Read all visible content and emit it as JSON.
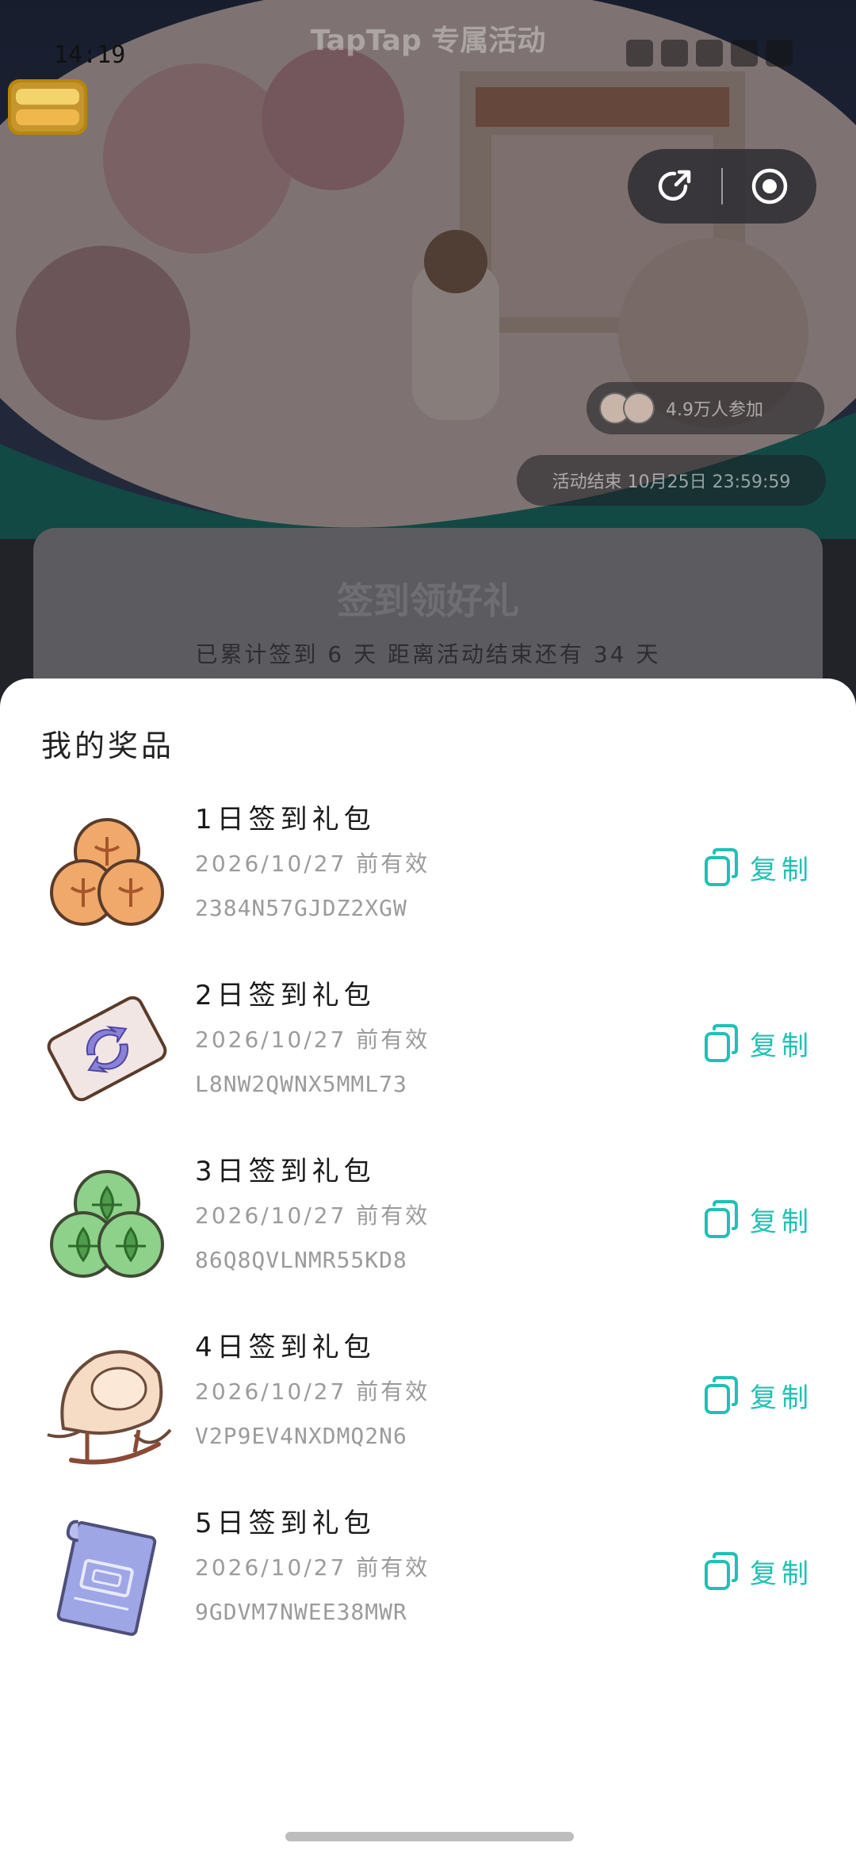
{
  "status_bar": {
    "time": "14:19"
  },
  "background_page": {
    "title": "TapTap 专属活动",
    "participants_text": "4.9万人参加",
    "end_time_text": "活动结束 10月25日 23:59:59",
    "card_title": "签到领好礼",
    "card_subtitle": "已累计签到 6 天  距离活动结束还有 34 天"
  },
  "prizes_sheet": {
    "title": "我的奖品",
    "copy_label": "复制",
    "accent_color": "#21c0b4",
    "items": [
      {
        "name": "1日签到礼包",
        "valid": "2026/10/27 前有效",
        "code": "2384N57GJDZ2XGW",
        "icon": "orange-coins-icon"
      },
      {
        "name": "2日签到礼包",
        "valid": "2026/10/27 前有效",
        "code": "L8NW2QWNX5MML73",
        "icon": "exchange-ticket-icon"
      },
      {
        "name": "3日签到礼包",
        "valid": "2026/10/27 前有效",
        "code": "86Q8QVLNMR55KD8",
        "icon": "green-coins-icon"
      },
      {
        "name": "4日签到礼包",
        "valid": "2026/10/27 前有效",
        "code": "V2P9EV4NXDMQ2N6",
        "icon": "rocking-chair-icon"
      },
      {
        "name": "5日签到礼包",
        "valid": "2026/10/27 前有效",
        "code": "9GDVM7NWEE38MWR",
        "icon": "blueprint-scroll-icon"
      }
    ]
  }
}
